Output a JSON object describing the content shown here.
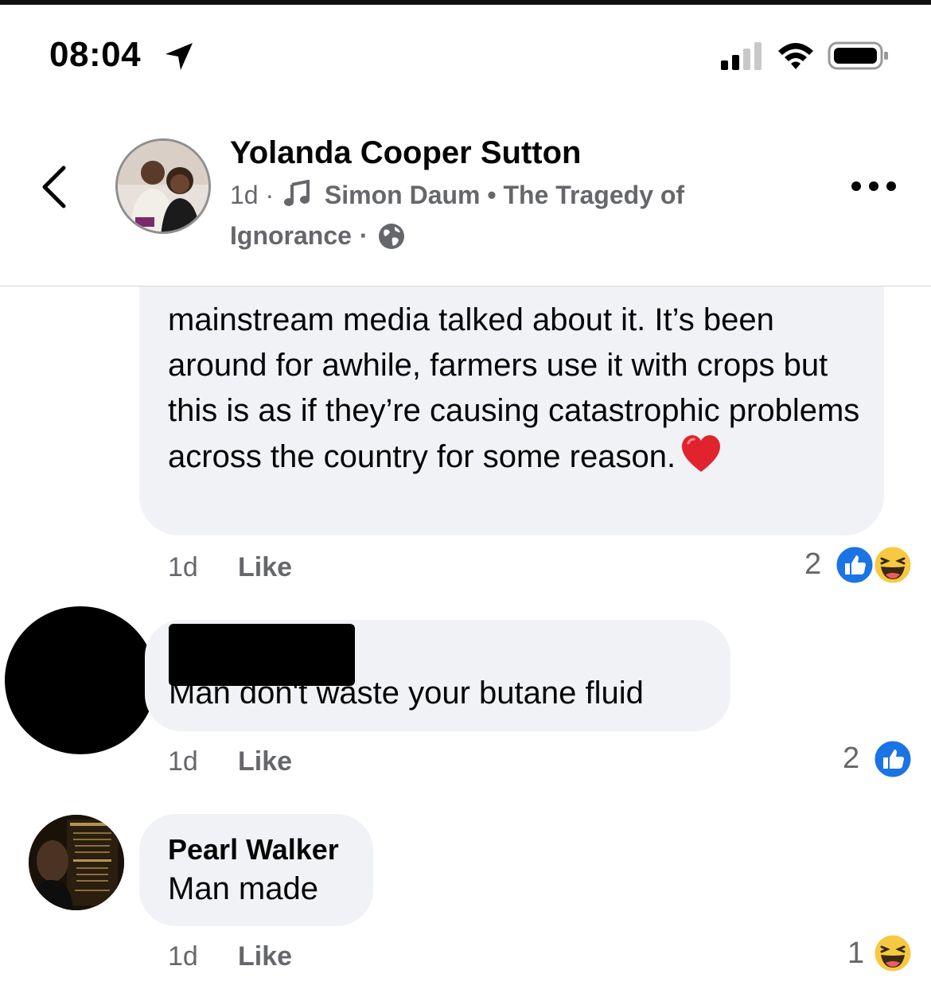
{
  "status_bar": {
    "time": "08:04"
  },
  "header": {
    "poster_name": "Yolanda Cooper Sutton",
    "age": "1d",
    "separator": "·",
    "music_artist": "Simon Daum",
    "music_sep": "•",
    "music_title_part1": "The Tragedy of",
    "music_title_part2": "Ignorance",
    "icons": [
      "back-chevron-icon",
      "music-note-icon",
      "globe-icon",
      "more-options-icon"
    ]
  },
  "comments": [
    {
      "text": "mainstream media talked about it. It’s been around for awhile, farmers use it with crops but this is as if they’re causing catastrophic problems across the country for some reason.",
      "emoji": "heart",
      "time": "1d",
      "like_label": "Like",
      "reaction_count": "2",
      "reactions": [
        "like",
        "haha"
      ]
    },
    {
      "author_redacted": true,
      "text": "Man don't waste your  butane fluid",
      "time": "1d",
      "like_label": "Like",
      "reaction_count": "2",
      "reactions": [
        "like"
      ]
    },
    {
      "author": "Pearl Walker",
      "text": "Man made",
      "time": "1d",
      "like_label": "Like",
      "reaction_count": "1",
      "reactions": [
        "haha"
      ]
    }
  ],
  "colors": {
    "bubble": "#f0f2f5",
    "meta_gray": "#65676b",
    "like_blue": "#1b74e4",
    "haha_yellow": "#f7c942"
  }
}
